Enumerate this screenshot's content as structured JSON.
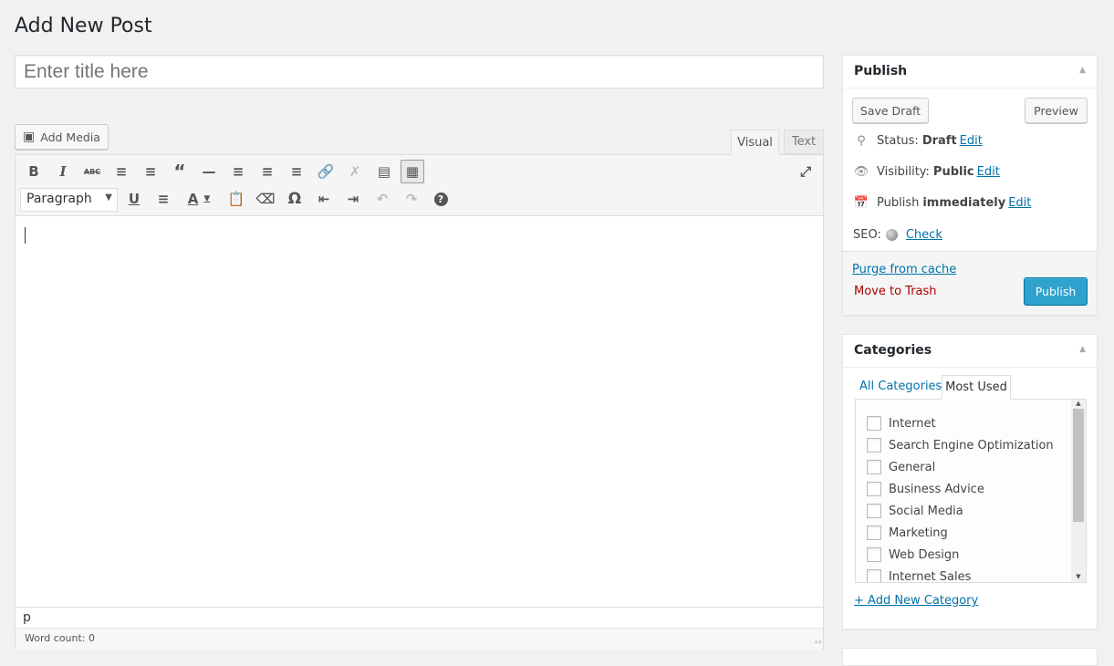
{
  "page_title": "Add New Post",
  "title_placeholder": "Enter title here",
  "add_media": "Add Media",
  "editor_tabs": {
    "visual": "Visual",
    "text": "Text"
  },
  "toolbar": {
    "format": "Paragraph"
  },
  "status_path": "p",
  "word_count": "Word count: 0",
  "publish": {
    "title": "Publish",
    "save_draft": "Save Draft",
    "preview": "Preview",
    "status_label": "Status:",
    "status_value": "Draft",
    "visibility_label": "Visibility:",
    "visibility_value": "Public",
    "publish_label": "Publish",
    "publish_value": "immediately",
    "edit": "Edit",
    "seo_label": "SEO:",
    "seo_check": "Check",
    "purge": "Purge from cache",
    "trash": "Move to Trash",
    "publish_button": "Publish",
    "accent": "#2ea2cc"
  },
  "categories": {
    "title": "Categories",
    "tab_all": "All Categories",
    "tab_most": "Most Used",
    "items": [
      "Internet",
      "Search Engine Optimization",
      "General",
      "Business Advice",
      "Social Media",
      "Marketing",
      "Web Design",
      "Internet Sales"
    ],
    "add_new": "+ Add New Category"
  }
}
